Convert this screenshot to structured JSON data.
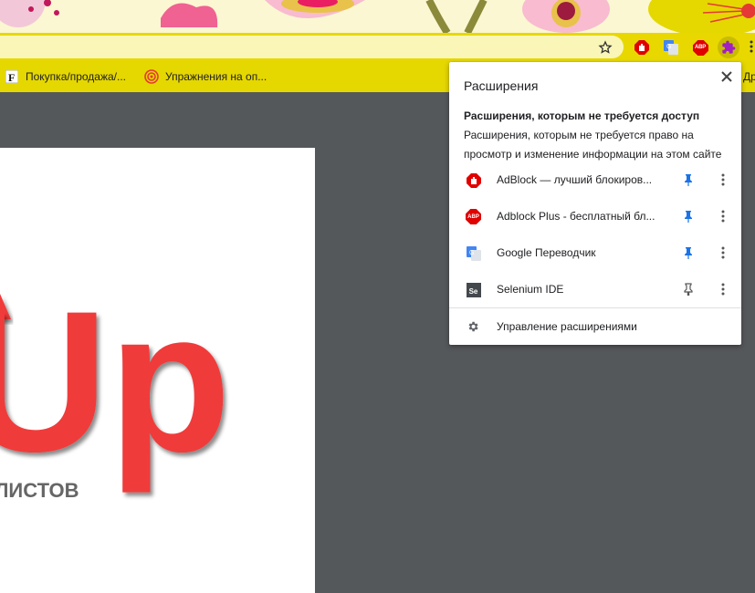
{
  "bookmarks": {
    "items": [
      {
        "label": "Покупка/продажа/...",
        "icon": "f-letter-icon"
      },
      {
        "label": "Упражнения на оп...",
        "icon": "target-icon"
      }
    ],
    "overflow_label": "Др"
  },
  "toolbar": {
    "star_icon": "star-icon",
    "extensions": [
      "adblock-icon",
      "google-translate-icon",
      "adblock-plus-icon",
      "extensions-puzzle-icon"
    ],
    "abp_text": "ABP"
  },
  "extensions_popup": {
    "title": "Расширения",
    "subheading": "Расширения, которым не требуется доступ",
    "description": "Расширения, которым не требуется право на просмотр и изменение информации на этом сайте",
    "items": [
      {
        "name": "AdBlock — лучший блокиров...",
        "icon": "adblock-icon",
        "pinned": true
      },
      {
        "name": "Adblock Plus - бесплатный бл...",
        "icon": "adblock-plus-icon",
        "pinned": true
      },
      {
        "name": "Google Переводчик",
        "icon": "google-translate-icon",
        "pinned": true
      },
      {
        "name": "Selenium IDE",
        "icon": "selenium-icon",
        "pinned": false
      }
    ],
    "manage_label": "Управление расширениями",
    "abp_badge": "ABP",
    "selenium_badge": "Se"
  },
  "page": {
    "logo_text": "Up",
    "logo_subtext": "ЛИСТОВ"
  },
  "colors": {
    "accent": "#1a73e8",
    "theme_yellow": "#e5d700",
    "logo_red": "#f03a3a",
    "content_bg": "#55585b"
  }
}
